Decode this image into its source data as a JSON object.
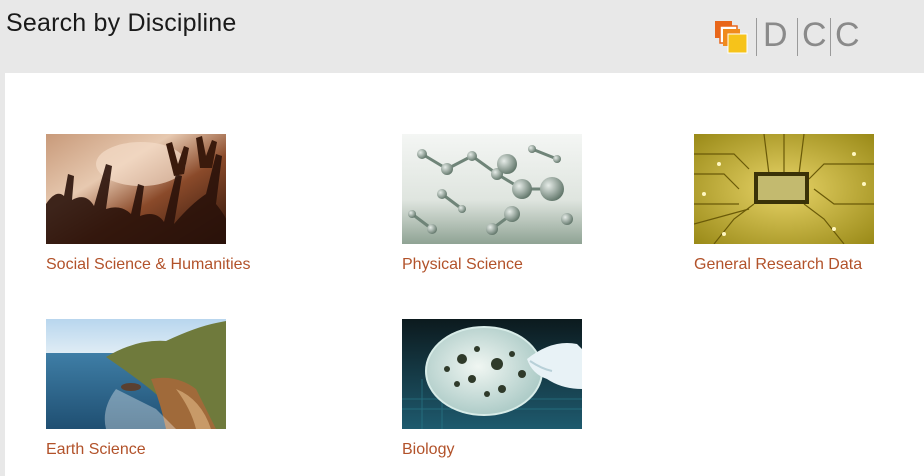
{
  "header": {
    "title": "Search by Discipline",
    "logo": {
      "letters": [
        "D",
        "C",
        "C"
      ],
      "colors": {
        "orange": "#e8661a",
        "yellow": "#f6c31a"
      }
    }
  },
  "disciplines": [
    {
      "label": "Social Science & Humanities",
      "image": "crowd-hands-image"
    },
    {
      "label": "Physical Science",
      "image": "molecules-image"
    },
    {
      "label": "General Research Data",
      "image": "circuit-board-image"
    },
    {
      "label": "Earth Science",
      "image": "coastline-image"
    },
    {
      "label": "Biology",
      "image": "petri-dish-image"
    }
  ],
  "colors": {
    "link": "#b2522a",
    "header_bg": "#e8e8e8"
  }
}
